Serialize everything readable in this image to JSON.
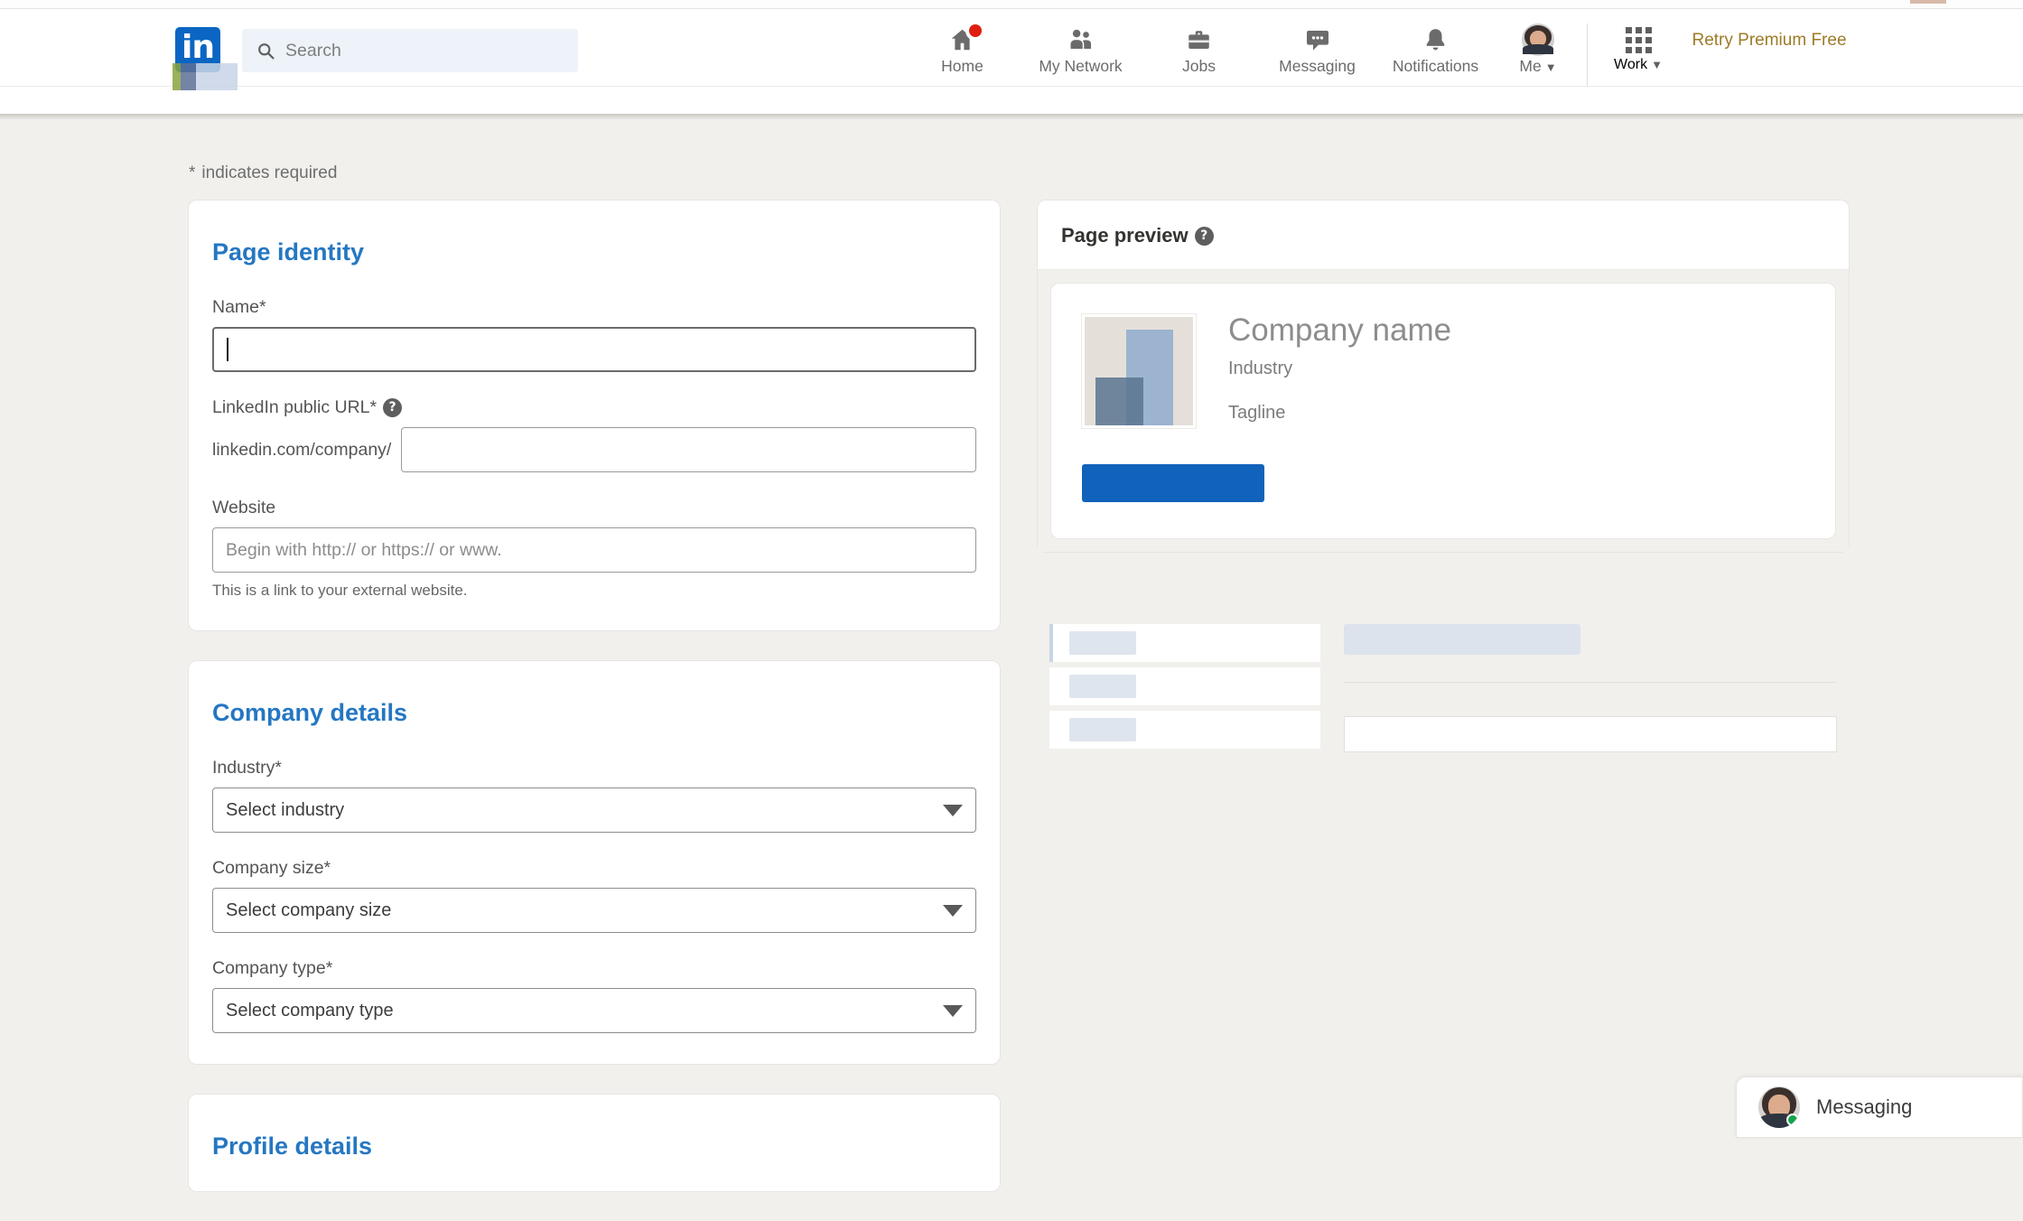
{
  "nav": {
    "logo_text": "in",
    "search": {
      "placeholder": "Search",
      "icon": "search-icon"
    },
    "items": [
      {
        "label": "Home",
        "icon": "home-icon",
        "badge": true
      },
      {
        "label": "My Network",
        "icon": "people-icon",
        "badge": false
      },
      {
        "label": "Jobs",
        "icon": "briefcase-icon",
        "badge": false
      },
      {
        "label": "Messaging",
        "icon": "chat-bubble-icon",
        "badge": false
      },
      {
        "label": "Notifications",
        "icon": "bell-icon",
        "badge": false
      }
    ],
    "me": {
      "label": "Me",
      "caret": "▼",
      "icon": "avatar"
    },
    "work": {
      "label": "Work",
      "caret": "▼",
      "icon": "grid-icon"
    },
    "premium": "Retry Premium Free"
  },
  "form": {
    "required_note": "indicates required",
    "required_star": "*",
    "page_identity": {
      "title": "Page identity",
      "name_label": "Name*",
      "name_value": "",
      "url_label": "LinkedIn public URL*",
      "url_prefix": "linkedin.com/company/",
      "url_value": "",
      "website_label": "Website",
      "website_placeholder": "Begin with http:// or https:// or www.",
      "website_hint": "This is a link to your external website."
    },
    "company_details": {
      "title": "Company details",
      "industry_label": "Industry*",
      "industry_value": "Select industry",
      "size_label": "Company size*",
      "size_value": "Select company size",
      "type_label": "Company type*",
      "type_value": "Select company type"
    },
    "profile_details": {
      "title": "Profile details"
    }
  },
  "preview": {
    "title": "Page preview",
    "help_icon": "question-mark-icon",
    "company_name": "Company name",
    "industry": "Industry",
    "tagline": "Tagline"
  },
  "messaging_widget": {
    "label": "Messaging"
  },
  "colors": {
    "brand_blue": "#0a66c2",
    "section_heading": "#2577c2",
    "cta_blue": "#1162ba",
    "premium_gold": "#9d7b26",
    "page_bg": "#f1f0ec",
    "notification_red": "#e01e0f",
    "online_green": "#16a34a"
  }
}
